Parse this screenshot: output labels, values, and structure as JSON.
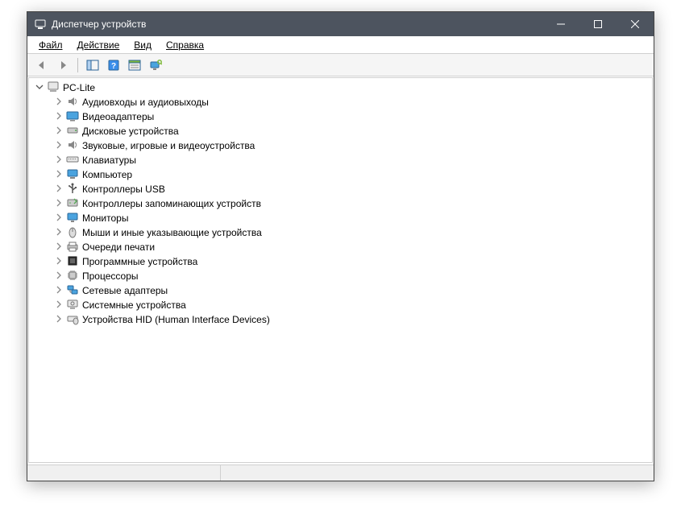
{
  "window": {
    "title": "Диспетчер устройств"
  },
  "menu": {
    "file": "Файл",
    "action": "Действие",
    "view": "Вид",
    "help": "Справка"
  },
  "tree": {
    "root": "PC-Lite",
    "items": [
      "Аудиовходы и аудиовыходы",
      "Видеоадаптеры",
      "Дисковые устройства",
      "Звуковые, игровые и видеоустройства",
      "Клавиатуры",
      "Компьютер",
      "Контроллеры USB",
      "Контроллеры запоминающих устройств",
      "Мониторы",
      "Мыши и иные указывающие устройства",
      "Очереди печати",
      "Программные устройства",
      "Процессоры",
      "Сетевые адаптеры",
      "Системные устройства",
      "Устройства HID (Human Interface Devices)"
    ]
  }
}
